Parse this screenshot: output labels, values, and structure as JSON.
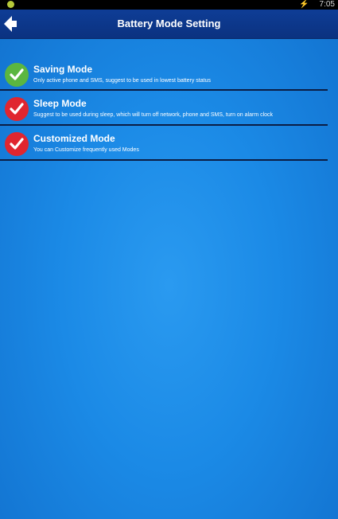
{
  "status_bar": {
    "time": "7:05",
    "app_icon": "app-notification-icon",
    "charge_icon": "charging-icon"
  },
  "header": {
    "title": "Battery Mode Setting",
    "back_icon": "back-arrow-icon"
  },
  "modes": [
    {
      "name": "Saving Mode",
      "description": "Only active phone and SMS, suggest to be used in lowest battery status",
      "selected": true,
      "indicator_color": "#5bb640"
    },
    {
      "name": "Sleep Mode",
      "description": "Suggest to be used during sleep, which will turn off network, phone and SMS, turn on alarm clock",
      "selected": false,
      "indicator_color": "#e0262f"
    },
    {
      "name": "Customized Mode",
      "description": "You can Customize frequently used Modes",
      "selected": false,
      "indicator_color": "#e0262f"
    }
  ],
  "colors": {
    "background": "#1b8ae6",
    "titlebar": "#0e3d96",
    "divider": "#0b1d44"
  }
}
